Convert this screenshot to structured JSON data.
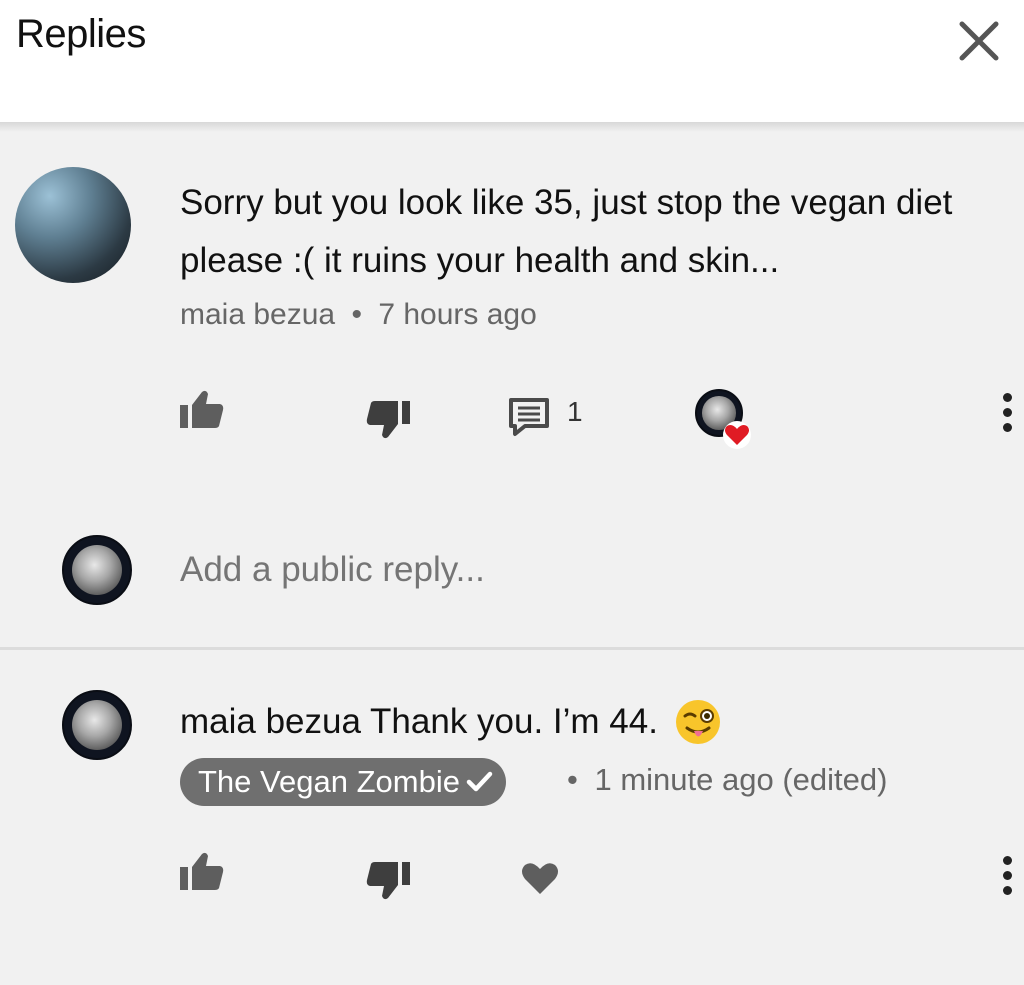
{
  "header": {
    "title": "Replies",
    "close_icon": "close-icon"
  },
  "comment": {
    "text": "Sorry but you look like 35, just stop the vegan diet please :( it ruins your health and skin...",
    "author": "maia bezua",
    "separator": "•",
    "time": "7 hours ago",
    "reply_count": "1",
    "icons": [
      "thumbs-up-icon",
      "thumbs-down-icon",
      "reply-icon",
      "creator-heart-icon",
      "more-vert-icon"
    ]
  },
  "reply_box": {
    "placeholder": "Add a public reply..."
  },
  "reply": {
    "text": "maia bezua Thank you. I’m 44.",
    "emoji": "winking-face-with-tongue",
    "author_chip": "The Vegan Zombie",
    "separator": "•",
    "time": "1 minute ago (edited)",
    "icons": [
      "thumbs-up-icon",
      "thumbs-down-icon",
      "heart-icon",
      "more-vert-icon"
    ]
  },
  "colors": {
    "background": "#f1f1f1",
    "header": "#ffffff",
    "chip": "#6f6f6f",
    "heart_red": "#e01b24",
    "icon_gray": "#5e5e5e"
  }
}
